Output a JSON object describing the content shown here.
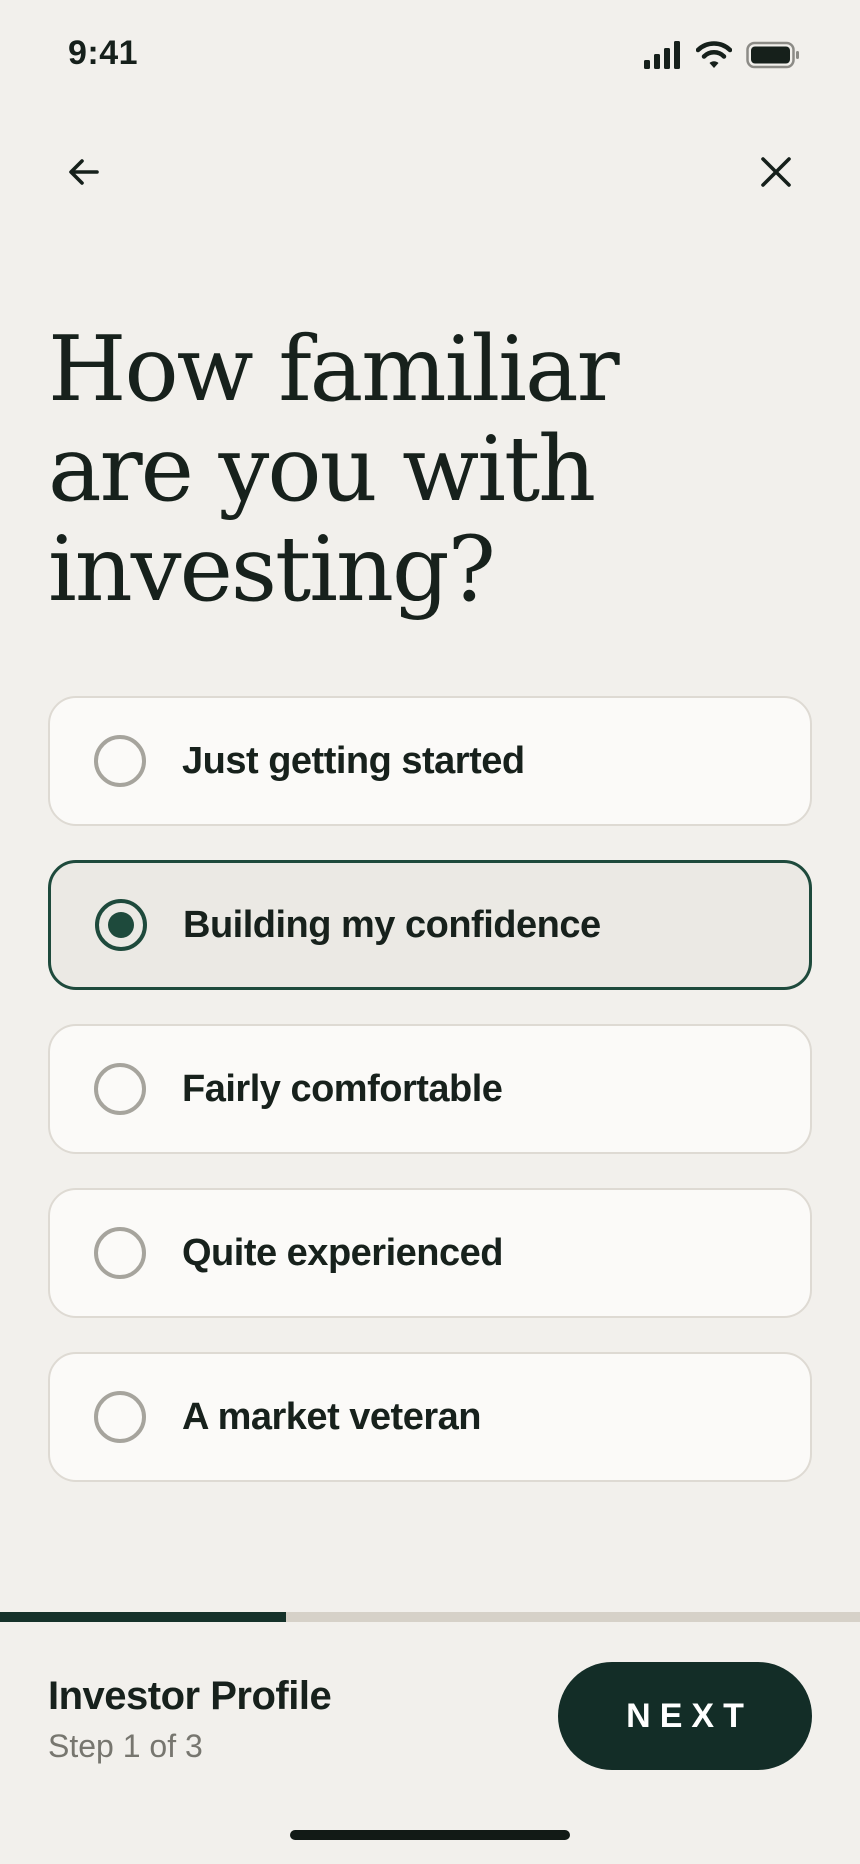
{
  "status_bar": {
    "time": "9:41"
  },
  "question": {
    "title": "How familiar are you with investing?"
  },
  "options": [
    {
      "label": "Just getting started",
      "selected": false
    },
    {
      "label": "Building my confidence",
      "selected": true
    },
    {
      "label": "Fairly comfortable",
      "selected": false
    },
    {
      "label": "Quite experienced",
      "selected": false
    },
    {
      "label": "A market veteran",
      "selected": false
    }
  ],
  "progress": {
    "fraction": 0.333
  },
  "footer": {
    "title": "Investor Profile",
    "step": "Step 1 of 3",
    "next_label": "NEXT"
  },
  "colors": {
    "accent": "#1e4a3c",
    "button": "#132d27",
    "background": "#f2f0ec"
  },
  "icons": {
    "back": "arrow-left-icon",
    "close": "close-icon"
  }
}
